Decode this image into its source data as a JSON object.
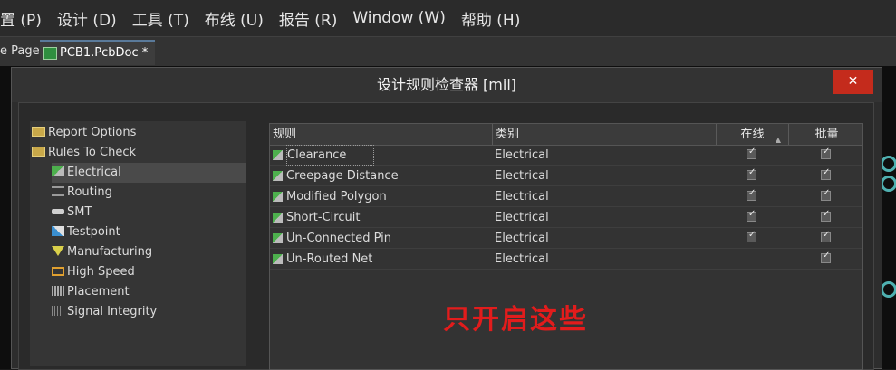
{
  "menu": [
    "置 (P)",
    "设计 (D)",
    "工具 (T)",
    "布线 (U)",
    "报告 (R)",
    "Window (W)",
    "帮助 (H)"
  ],
  "tabs": {
    "partial": "e Page",
    "active": "PCB1.PcbDoc *"
  },
  "dialog": {
    "title": "设计规则检查器 [mil]",
    "close": "✕"
  },
  "tree": {
    "report_options": "Report Options",
    "rules_to_check": "Rules To Check",
    "items": [
      "Electrical",
      "Routing",
      "SMT",
      "Testpoint",
      "Manufacturing",
      "High Speed",
      "Placement",
      "Signal Integrity"
    ]
  },
  "table": {
    "headers": {
      "rule": "规则",
      "category": "类别",
      "online": "在线",
      "batch": "批量"
    },
    "rows": [
      {
        "name": "Clearance",
        "category": "Electrical",
        "online": true,
        "batch": true
      },
      {
        "name": "Creepage Distance",
        "category": "Electrical",
        "online": true,
        "batch": true
      },
      {
        "name": "Modified Polygon",
        "category": "Electrical",
        "online": true,
        "batch": true
      },
      {
        "name": "Short-Circuit",
        "category": "Electrical",
        "online": true,
        "batch": true
      },
      {
        "name": "Un-Connected Pin",
        "category": "Electrical",
        "online": true,
        "batch": true
      },
      {
        "name": "Un-Routed Net",
        "category": "Electrical",
        "online": false,
        "batch": true
      }
    ]
  },
  "annotation": "只开启这些",
  "colors": {
    "accent_red": "#e21c1c",
    "close_red": "#c42b1c"
  }
}
